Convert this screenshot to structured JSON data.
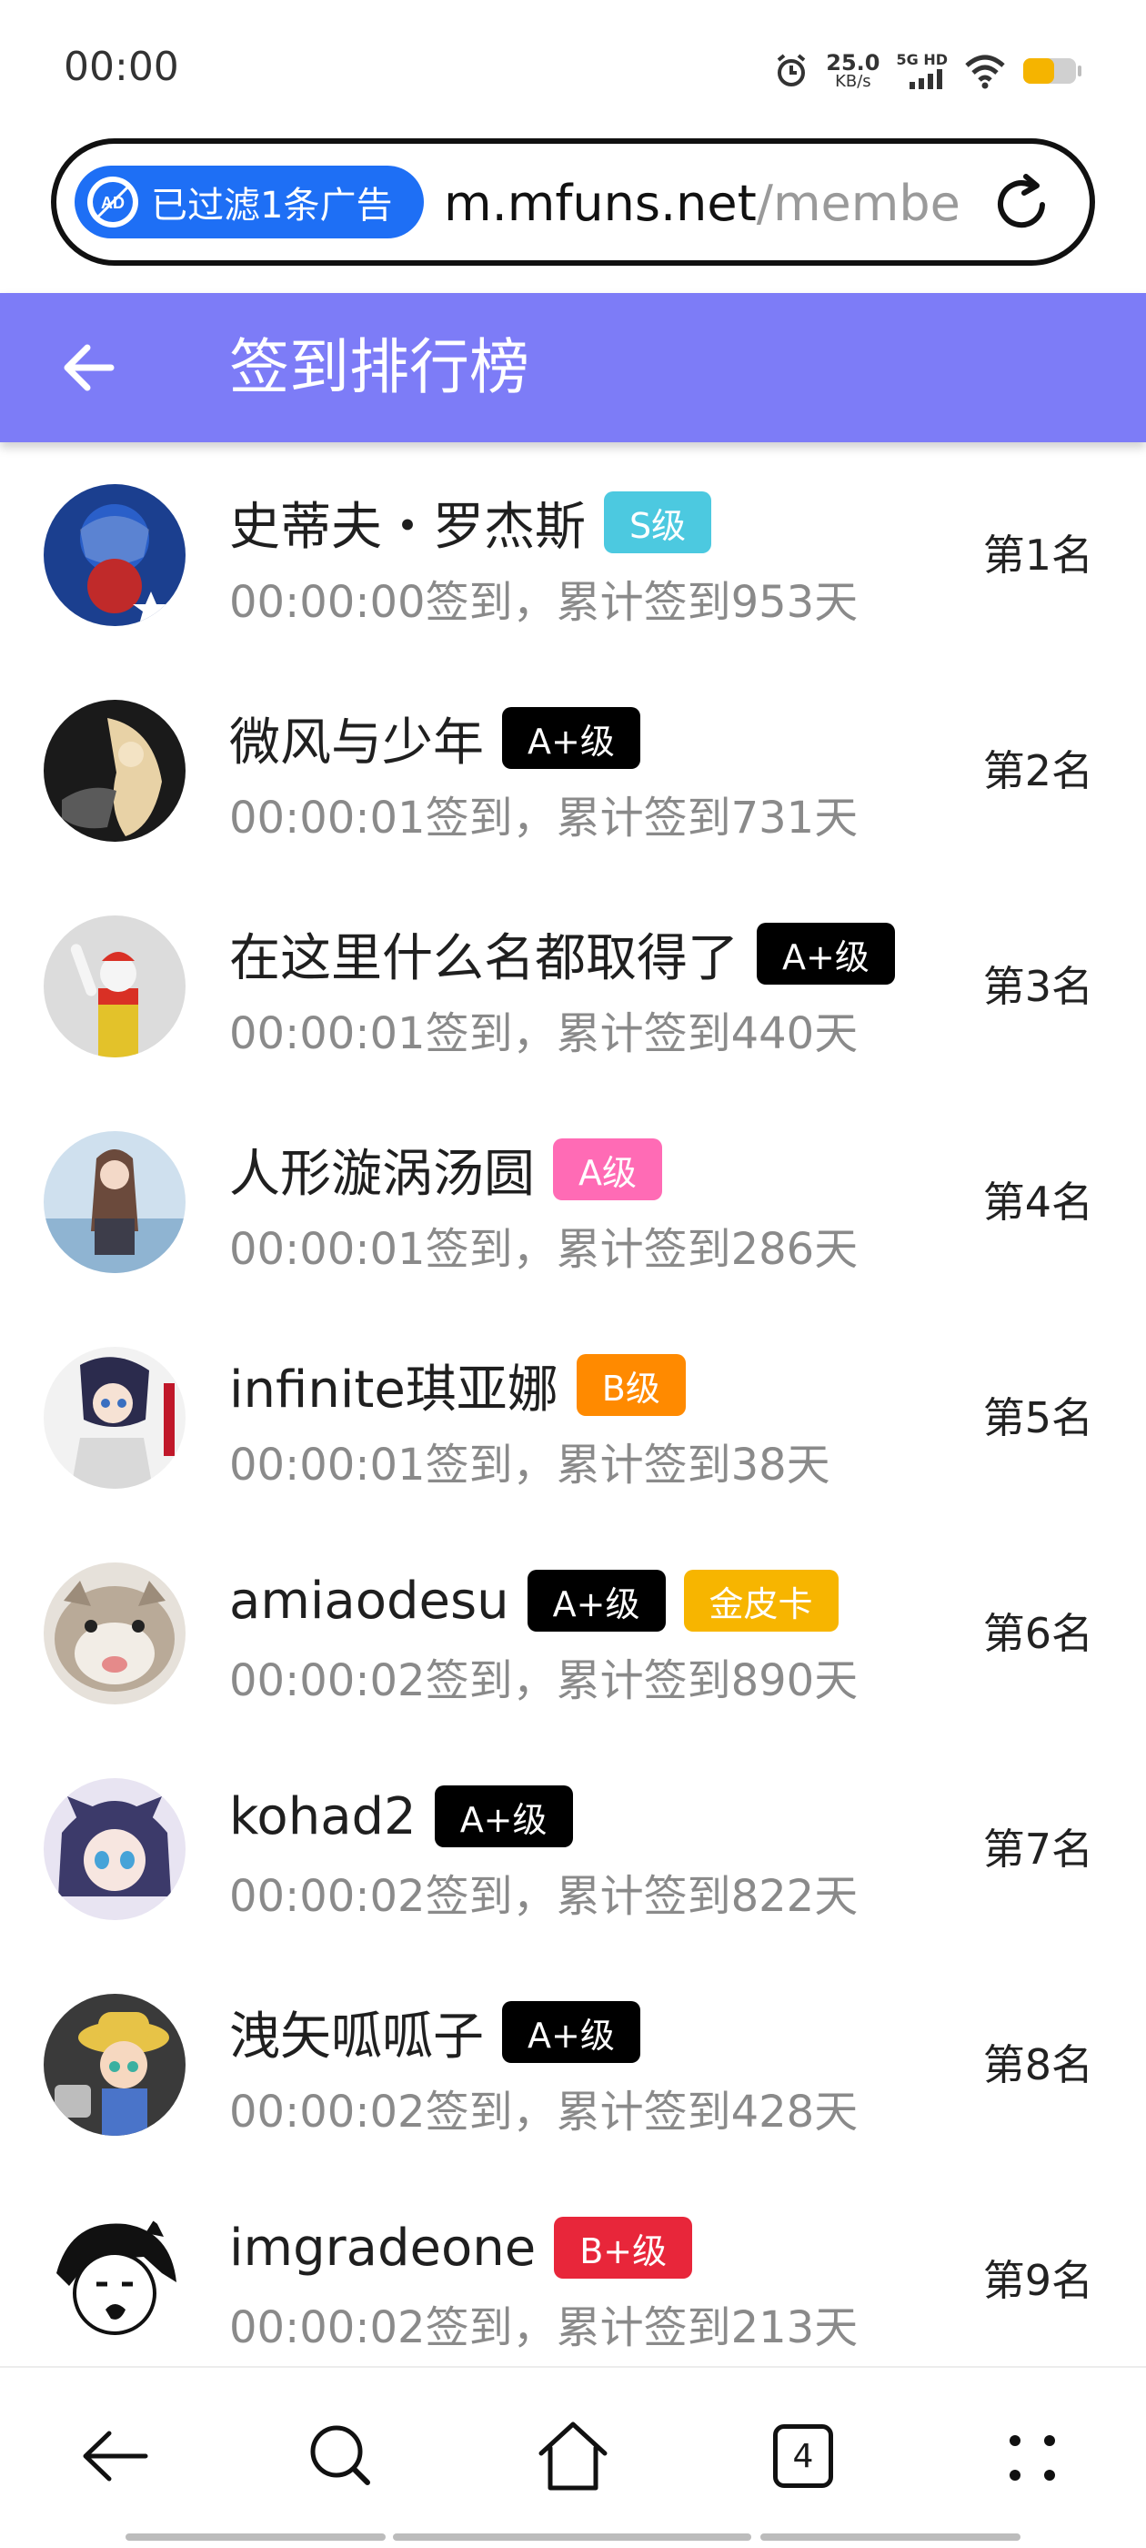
{
  "status_bar": {
    "time": "00:00",
    "net_speed_value": "25.0",
    "net_speed_unit": "KB/s",
    "network": "5G HD",
    "icons": [
      "alarm-icon",
      "signal-icon",
      "wifi-icon",
      "battery-icon"
    ],
    "battery_color": "#f5b400"
  },
  "browser": {
    "ad_filter_label": "已过滤1条广告",
    "url_domain": "m.mfuns.net",
    "url_path": "/membe",
    "accent": "#1e6ff5"
  },
  "appbar": {
    "title": "签到排行榜",
    "color": "#7d7cf7"
  },
  "ranking": [
    {
      "name": "史蒂夫・罗杰斯",
      "badges": [
        {
          "label": "S级",
          "color": "#4cc9e0"
        }
      ],
      "detail": "00:00:00签到，累计签到953天",
      "rank": "第1名"
    },
    {
      "name": "微风与少年",
      "badges": [
        {
          "label": "A+级",
          "color": "#000000"
        }
      ],
      "detail": "00:00:01签到，累计签到731天",
      "rank": "第2名"
    },
    {
      "name": "在这里什么名都取得了",
      "badges": [
        {
          "label": "A+级",
          "color": "#000000"
        }
      ],
      "detail": "00:00:01签到，累计签到440天",
      "rank": "第3名"
    },
    {
      "name": "人形漩涡汤圆",
      "badges": [
        {
          "label": "A级",
          "color": "#ff6bb5"
        }
      ],
      "detail": "00:00:01签到，累计签到286天",
      "rank": "第4名"
    },
    {
      "name": "infinite琪亚娜",
      "badges": [
        {
          "label": "B级",
          "color": "#ff8a00"
        }
      ],
      "detail": "00:00:01签到，累计签到38天",
      "rank": "第5名"
    },
    {
      "name": "amiaodesu",
      "badges": [
        {
          "label": "A+级",
          "color": "#000000"
        },
        {
          "label": "金皮卡",
          "color": "#f7b500"
        }
      ],
      "detail": "00:00:02签到，累计签到890天",
      "rank": "第6名"
    },
    {
      "name": "kohad2",
      "badges": [
        {
          "label": "A+级",
          "color": "#000000"
        }
      ],
      "detail": "00:00:02签到，累计签到822天",
      "rank": "第7名"
    },
    {
      "name": "洩矢呱呱子",
      "badges": [
        {
          "label": "A+级",
          "color": "#000000"
        }
      ],
      "detail": "00:00:02签到，累计签到428天",
      "rank": "第8名"
    },
    {
      "name": "imgradeone",
      "badges": [
        {
          "label": "B+级",
          "color": "#e8263a"
        }
      ],
      "detail": "00:00:02签到，累计签到213天",
      "rank": "第9名"
    }
  ],
  "bottom_nav": {
    "tab_count": "4",
    "items": [
      "back-icon",
      "search-icon",
      "home-icon",
      "tabs-icon",
      "menu-icon"
    ]
  }
}
